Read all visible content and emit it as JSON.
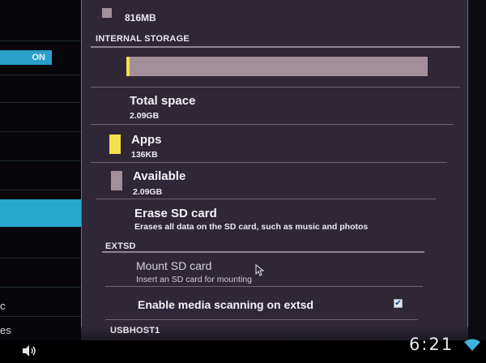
{
  "left_pane": {
    "toggle_label": "ON",
    "partial_label_1": "c",
    "partial_label_2": "es"
  },
  "storage": {
    "top_value": "816MB",
    "internal_header": "INTERNAL STORAGE",
    "used_fraction": 0.01,
    "total": {
      "title": "Total space",
      "value": "2.09GB"
    },
    "apps": {
      "title": "Apps",
      "value": "136KB",
      "color": "#f5e04a"
    },
    "available": {
      "title": "Available",
      "value": "2.09GB",
      "color": "#a38f9a"
    },
    "erase": {
      "title": "Erase SD card",
      "summary": "Erases all data on the SD card, such as music and photos"
    },
    "extsd_header": "EXTSD",
    "mount": {
      "title": "Mount SD card",
      "summary": "Insert an SD card for mounting"
    },
    "media_scan": {
      "title": "Enable media scanning on extsd",
      "checked": true,
      "check_glyph": "✔"
    },
    "usbhost_header": "USBHOST1"
  },
  "system_bar": {
    "time": "6:21",
    "icons": [
      "speaker-icon",
      "wifi-icon"
    ]
  }
}
